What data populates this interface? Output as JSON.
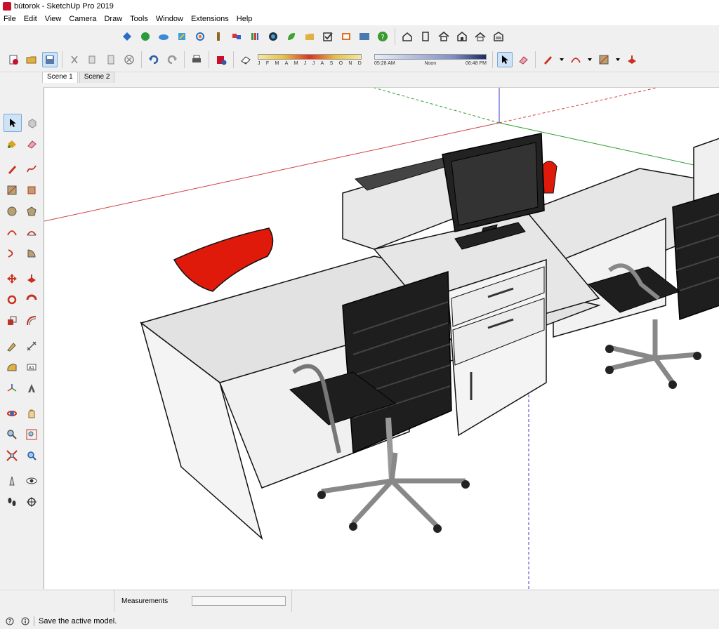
{
  "window": {
    "title": "bútorok - SketchUp Pro 2019"
  },
  "menu": [
    "File",
    "Edit",
    "View",
    "Camera",
    "Draw",
    "Tools",
    "Window",
    "Extensions",
    "Help"
  ],
  "toolbar_top": [
    "component-icon",
    "sphere-icon",
    "cloud-icon",
    "pencil-green-icon",
    "gear-icon",
    "bottle-icon",
    "cubes-icon",
    "books-icon",
    "target-icon",
    "leaf-icon",
    "folder-icon",
    "checkbox-icon",
    "film-icon",
    "fpc-icon",
    "help-icon",
    "house-icon",
    "door-icon",
    "home-icon",
    "house-outline-icon",
    "roof-icon",
    "garage-icon"
  ],
  "toolbar_main": [
    "new-file-icon",
    "open-folder-icon",
    "save-icon",
    "cut-icon",
    "copy-icon",
    "paste-icon",
    "delete-icon",
    "undo-icon",
    "redo-icon",
    "print-icon",
    "model-info-icon"
  ],
  "shadows": {
    "months": [
      "J",
      "F",
      "M",
      "A",
      "M",
      "J",
      "J",
      "A",
      "S",
      "O",
      "N",
      "D"
    ],
    "time_start": "05:28 AM",
    "time_noon": "Noon",
    "time_end": "06:48 PM"
  },
  "scenes": [
    {
      "label": "Scene 1",
      "active": true
    },
    {
      "label": "Scene 2",
      "active": false
    }
  ],
  "left_tools": [
    [
      "select-icon",
      "component-tool-icon"
    ],
    [
      "paint-bucket-icon",
      "eraser-icon"
    ],
    [
      "line-icon",
      "freehand-icon"
    ],
    [
      "rectangle-icon",
      "rotated-rectangle-icon"
    ],
    [
      "circle-icon",
      "polygon-icon"
    ],
    [
      "arc-icon",
      "two-point-arc-icon"
    ],
    [
      "three-point-arc-icon",
      "pie-icon"
    ],
    [
      "move-icon",
      "push-pull-icon"
    ],
    [
      "rotate-icon",
      "follow-me-icon"
    ],
    [
      "scale-icon",
      "offset-icon"
    ],
    [
      "tape-measure-icon",
      "dimension-icon"
    ],
    [
      "protractor-icon",
      "text-icon"
    ],
    [
      "axes-icon",
      "3d-text-icon"
    ],
    [
      "orbit-icon",
      "pan-icon"
    ],
    [
      "zoom-icon",
      "zoom-window-icon"
    ],
    [
      "zoom-extents-icon",
      "previous-view-icon"
    ],
    [
      "position-camera-icon",
      "look-around-icon"
    ],
    [
      "walk-icon",
      "section-plane-icon"
    ]
  ],
  "status": {
    "measurements_label": "Measurements",
    "message": "Save the active model."
  },
  "colors": {
    "accent_red": "#e01a0b",
    "axis_red": "#d04040",
    "axis_green": "#2e9a2e",
    "axis_blue": "#3a3ad0"
  }
}
